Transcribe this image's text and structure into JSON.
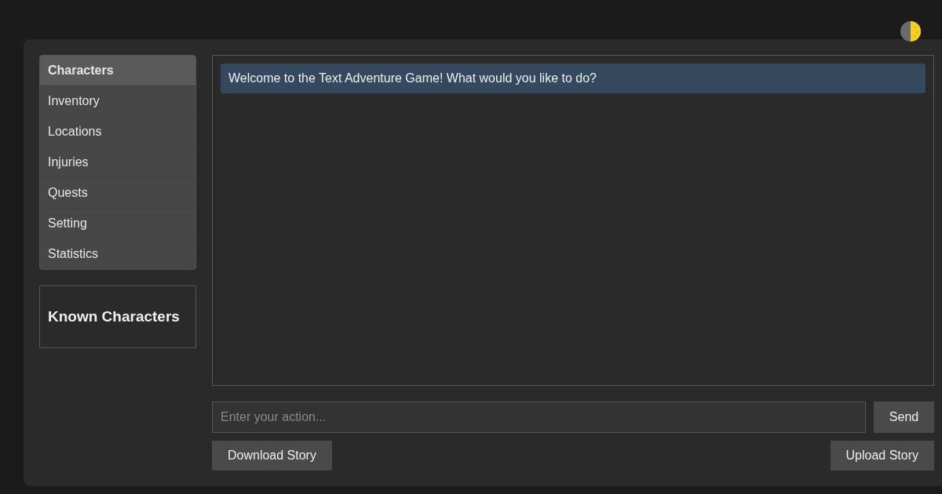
{
  "theme_toggle": {
    "kind": "half-moon"
  },
  "sidebar": {
    "items": [
      {
        "label": "Characters",
        "selected": true
      },
      {
        "label": "Inventory",
        "selected": false
      },
      {
        "label": "Locations",
        "selected": false
      },
      {
        "label": "Injuries",
        "selected": false
      },
      {
        "label": "Quests",
        "selected": false
      },
      {
        "label": "Setting",
        "selected": false
      },
      {
        "label": "Statistics",
        "selected": false
      }
    ]
  },
  "info_panel": {
    "title": "Known Characters"
  },
  "chat": {
    "messages": [
      {
        "text": "Welcome to the Text Adventure Game! What would you like to do?"
      }
    ]
  },
  "action_input": {
    "placeholder": "Enter your action..."
  },
  "send_button": "Send",
  "download_button": "Download Story",
  "upload_button": "Upload Story"
}
